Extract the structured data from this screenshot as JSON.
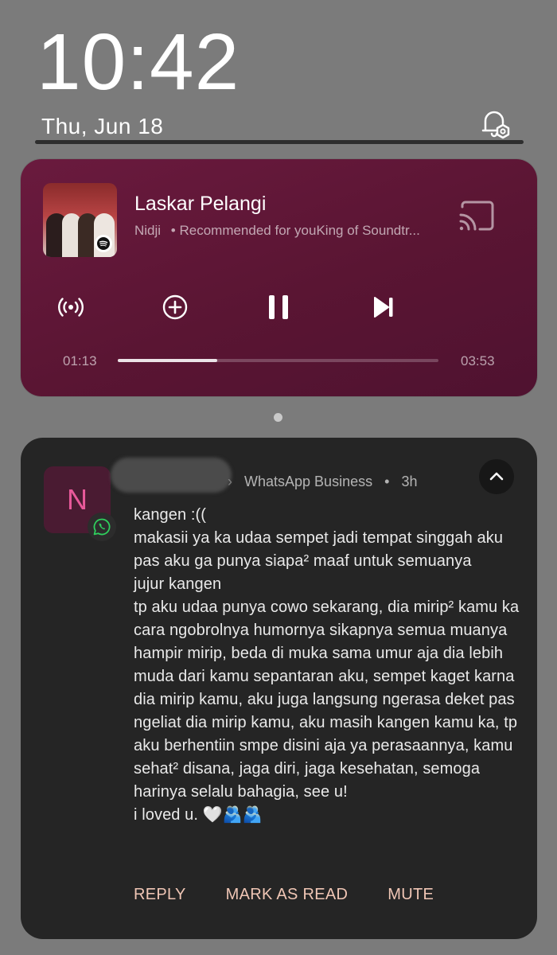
{
  "lockscreen": {
    "time": "10:42",
    "date": "Thu, Jun 18"
  },
  "media": {
    "title": "Laskar Pelangi",
    "artist": "Nidji",
    "source": "• Recommended for youKing of Soundtr...",
    "elapsed": "01:13",
    "duration": "03:53",
    "progress": 0.31,
    "controls": [
      "broadcast",
      "add",
      "pause",
      "next"
    ],
    "accent": "#5e1636"
  },
  "notification": {
    "avatar_letter": "N",
    "app": "WhatsApp Business",
    "time": "3h",
    "message": "kangen :((\nmakasii ya ka udaa sempet jadi tempat singgah aku pas aku ga punya siapa² maaf untuk semuanya\njujur kangen\ntp aku udaa punya cowo sekarang, dia mirip² kamu ka cara ngobrolnya humornya sikapnya semua muanya hampir mirip, beda di muka sama umur aja dia lebih muda dari kamu sepantaran aku, sempet kaget karna dia mirip kamu, aku juga langsung ngerasa deket pas ngeliat dia mirip kamu, aku masih kangen kamu ka, tp aku berhentiin smpe disini aja ya perasaannya, kamu sehat² disana, jaga diri, jaga kesehatan, semoga harinya selalu bahagia, see u!\ni loved u. 🤍🫂🫂",
    "actions": {
      "reply": "REPLY",
      "mark_read": "MARK AS READ",
      "mute": "MUTE"
    },
    "accent": "#f0c6b5"
  }
}
